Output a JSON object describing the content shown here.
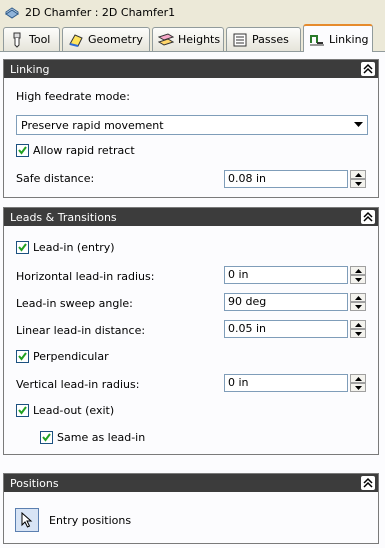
{
  "window": {
    "title": "2D Chamfer : 2D Chamfer1"
  },
  "tabs": [
    {
      "label": "Tool",
      "icon": "tool-icon"
    },
    {
      "label": "Geometry",
      "icon": "geometry-icon"
    },
    {
      "label": "Heights",
      "icon": "heights-icon"
    },
    {
      "label": "Passes",
      "icon": "passes-icon"
    },
    {
      "label": "Linking",
      "icon": "linking-icon",
      "active": true
    }
  ],
  "linking": {
    "header": "Linking",
    "feedrate_label": "High feedrate mode:",
    "feedrate_value": "Preserve rapid movement",
    "allow_rapid_retract": {
      "label": "Allow rapid retract",
      "checked": true
    },
    "safe_distance": {
      "label": "Safe distance:",
      "value": "0.08 in"
    }
  },
  "leads": {
    "header": "Leads & Transitions",
    "lead_in": {
      "label": "Lead-in (entry)",
      "checked": true
    },
    "horizontal_radius": {
      "label": "Horizontal lead-in radius:",
      "value": "0 in"
    },
    "sweep_angle": {
      "label": "Lead-in sweep angle:",
      "value": "90 deg"
    },
    "linear_distance": {
      "label": "Linear lead-in distance:",
      "value": "0.05 in"
    },
    "perpendicular": {
      "label": "Perpendicular",
      "checked": true
    },
    "vertical_radius": {
      "label": "Vertical lead-in radius:",
      "value": "0 in"
    },
    "lead_out": {
      "label": "Lead-out (exit)",
      "checked": true
    },
    "same_as_lead_in": {
      "label": "Same as lead-in",
      "checked": true
    }
  },
  "positions": {
    "header": "Positions",
    "entry_positions_label": "Entry positions"
  },
  "colors": {
    "header_bg": "#3c3c3c",
    "active_tab_accent": "#e68b2c",
    "panel_bg": "#fcfcfe"
  }
}
